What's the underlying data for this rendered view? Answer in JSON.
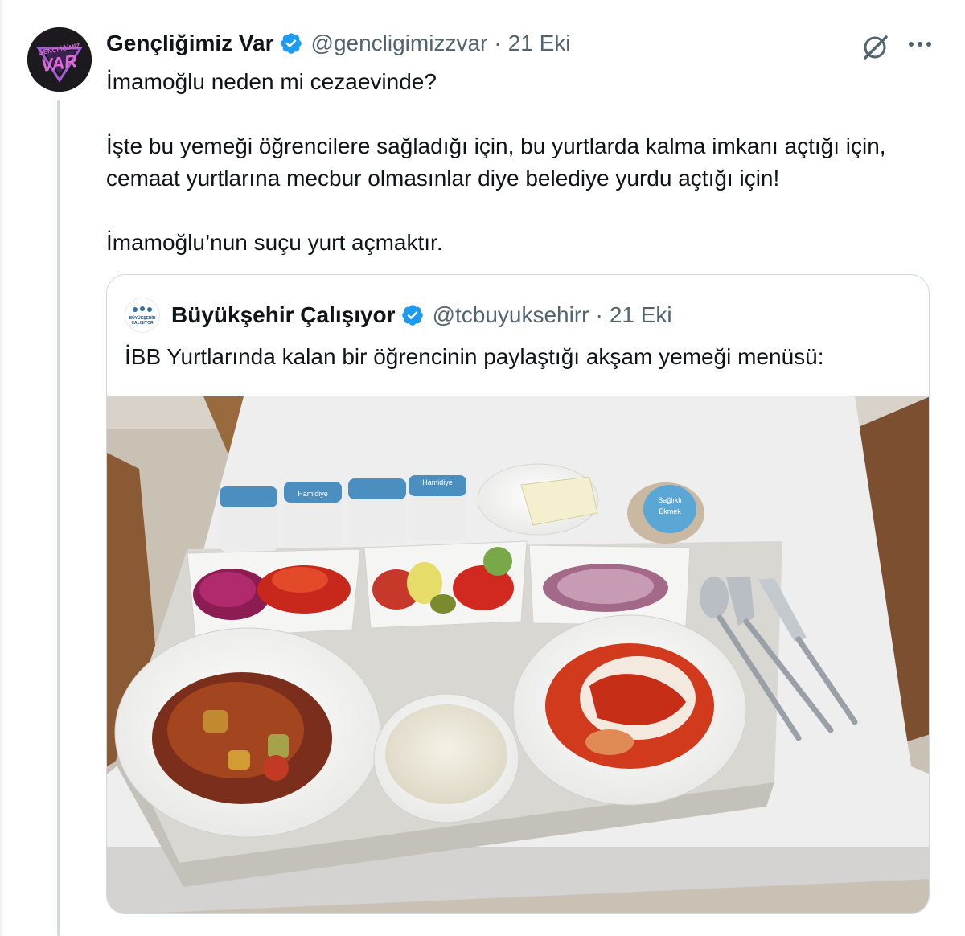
{
  "tweet": {
    "author": {
      "display_name": "Gençliğimiz Var",
      "handle": "@gencligimizzvar",
      "verified": true,
      "avatar_lettering": [
        "GENÇLİĞİMİZ",
        "VAR"
      ]
    },
    "separator": "·",
    "time": "21 Eki",
    "paragraphs": [
      "İmamoğlu neden mi cezaevinde?",
      "İşte bu yemeği öğrencilere sağladığı için, bu yurtlarda kalma imkanı açtığı için, cemaat yurtlarına mecbur olmasınlar diye belediye yurdu açtığı için!",
      "İmamoğlu’nun suçu yurt açmaktır."
    ],
    "actions": {
      "grok_icon": "grok-icon",
      "more_icon": "more-horizontal-icon"
    }
  },
  "quote": {
    "author": {
      "display_name": "Büyükşehir Çalışıyor",
      "handle": "@tcbuyuksehirr",
      "verified": true,
      "avatar_lettering": [
        "BÜYÜKŞEHİR",
        "ÇALIŞIYOR"
      ]
    },
    "separator": "·",
    "time": "21 Eki",
    "text": "İBB Yurtlarında kalan bir öğrencinin paylaştığı akşam yemeği menüsü:",
    "media": {
      "kind": "photo",
      "subject": "dinner tray",
      "water_cup_label": "Hamidiye",
      "bread_package_label": [
        "Sağlıklı",
        "Ekmek"
      ]
    }
  },
  "colors": {
    "text": "#0f1419",
    "secondary": "#536471",
    "verified": "#1d9bf0",
    "border": "#cfd9de"
  }
}
